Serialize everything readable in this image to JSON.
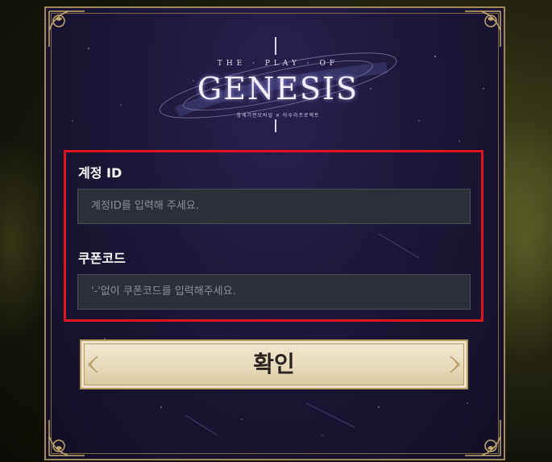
{
  "logo": {
    "top_text": "THE · PLAY · OF",
    "title": "GENESIS",
    "subtitle": "창세기전모바일 ✕ 아수라프로젝트"
  },
  "form": {
    "account_label": "계정 ID",
    "account_placeholder": "계정ID를 입력해 주세요.",
    "coupon_label": "쿠폰코드",
    "coupon_placeholder": "'-'없이 쿠폰코드를 입력해주세요."
  },
  "confirm_button": {
    "label": "확인"
  },
  "colors": {
    "highlight_border": "#e0141e",
    "panel_bg": "#1c1638",
    "gold_frame": "#a08a5a",
    "button_bg": "#f2e9d3"
  }
}
